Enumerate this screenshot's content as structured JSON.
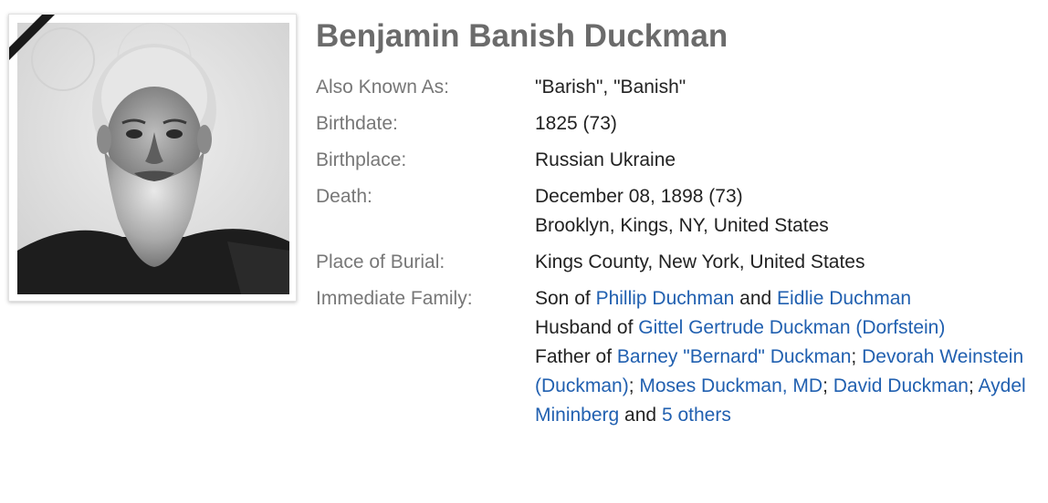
{
  "profile": {
    "name": "Benjamin Banish Duckman",
    "photo_alt": "portrait photo"
  },
  "fields": {
    "aka": {
      "label": "Also Known As:",
      "value": "\"Barish\", \"Banish\""
    },
    "birthdate": {
      "label": "Birthdate:",
      "value": "1825 (73)"
    },
    "birthplace": {
      "label": "Birthplace:",
      "value": "Russian Ukraine"
    },
    "death": {
      "label": "Death:",
      "date": "December 08, 1898 (73)",
      "place": "Brooklyn, Kings, NY, United States"
    },
    "burial": {
      "label": "Place of Burial:",
      "value": "Kings County, New York, United States"
    },
    "family": {
      "label": "Immediate Family:",
      "son_of_prefix": "Son of ",
      "father_1": "Phillip Duchman",
      "and_1": " and ",
      "mother": "Eidlie Duchman",
      "husband_of_prefix": "Husband of ",
      "spouse": "Gittel Gertrude Duckman (Dorfstein)",
      "father_of_prefix": "Father of ",
      "child_1": "Barney \"Bernard\" Duckman",
      "sep_1": "; ",
      "child_2": "Devorah Weinstein (Duckman)",
      "sep_2": "; ",
      "child_3": "Moses Duckman, MD",
      "sep_3": ";",
      "child_4": "David Duckman",
      "sep_4": "; ",
      "child_5": "Aydel Mininberg",
      "and_2": " and ",
      "others": "5 others"
    }
  },
  "colors": {
    "name": "#6b6b6b",
    "label": "#777777",
    "value": "#222222",
    "link": "#2160b0"
  }
}
